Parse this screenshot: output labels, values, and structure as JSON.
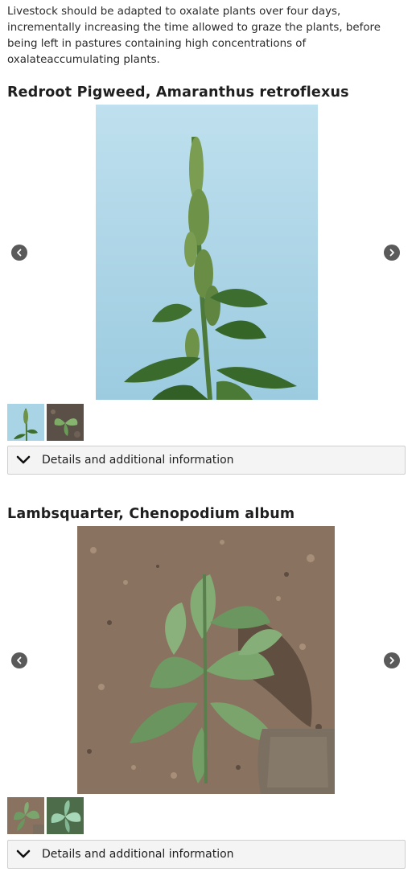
{
  "intro": {
    "text": "Livestock should be adapted to oxalate plants over four days, incrementally increasing the time allowed to graze the plants, before being left in pastures containing high concentrations of oxalateaccumulating plants."
  },
  "sections": [
    {
      "title": "Redroot Pigweed, Amaranthus retroflexus",
      "prev_icon": "chevron-left-icon",
      "next_icon": "chevron-right-icon",
      "details_label": "Details and additional information",
      "details_icon": "chevron-down-icon"
    },
    {
      "title": "Lambsquarter, Chenopodium album",
      "prev_icon": "chevron-left-icon",
      "next_icon": "chevron-right-icon",
      "details_label": "Details and additional information",
      "details_icon": "chevron-down-icon"
    }
  ],
  "colors": {
    "arrow_bg": "#5a5a5a",
    "details_bg": "#f4f4f4",
    "details_border": "#cfcfcf"
  }
}
